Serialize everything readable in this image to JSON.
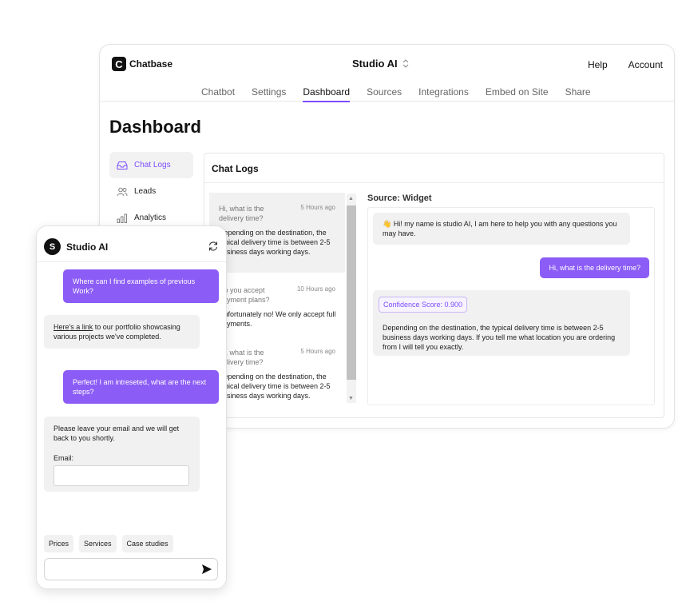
{
  "brand": {
    "name": "Chatbase",
    "logo_letter": "C"
  },
  "header": {
    "project": "Studio AI",
    "project_chevron": "⌃⌄",
    "links": {
      "help": "Help",
      "account": "Account"
    }
  },
  "tabs": [
    {
      "label": "Chatbot"
    },
    {
      "label": "Settings"
    },
    {
      "label": "Dashboard",
      "active": true
    },
    {
      "label": "Sources"
    },
    {
      "label": "Integrations"
    },
    {
      "label": "Embed on Site"
    },
    {
      "label": "Share"
    }
  ],
  "page_title": "Dashboard",
  "sidebar": {
    "items": [
      {
        "label": "Chat Logs",
        "icon": "inbox-icon",
        "active": true
      },
      {
        "label": "Leads",
        "icon": "users-icon"
      },
      {
        "label": "Analytics",
        "icon": "bar-chart-icon"
      }
    ]
  },
  "chat_logs": {
    "title": "Chat Logs",
    "items": [
      {
        "question": "Hi, what is the delivery time?",
        "time": "5 Hours ago",
        "answer": "Depending on the destination, the typical delivery time is between 2-5 business days working days."
      },
      {
        "question": "Do you accept payment plans?",
        "time": "10 Hours ago",
        "answer": "Unfortunately no! We only accept full payments."
      },
      {
        "question": "Hi, what is the delivery time?",
        "time": "5 Hours ago",
        "answer": "Depending on the destination, the typical delivery time is between 2-5 business days working days."
      }
    ]
  },
  "conversation": {
    "source": "Source: Widget",
    "bot_greeting": "👋 Hi! my name is studio AI, I am here to help you with any questions you may have.",
    "user_message": "Hi, what is the delivery time?",
    "confidence": "Confidence Score: 0.900",
    "bot_answer": "Depending on the destination, the typical delivery time is between 2-5 business days working days. If you tell me what location you are ordering from I will tell you exactly."
  },
  "widget": {
    "avatar_letter": "S",
    "title": "Studio AI",
    "messages": {
      "user1": "Where can I find examples of previous Work?",
      "bot1_link": "Here's a link",
      "bot1_rest": " to our portfolio showcasing various projects we've completed.",
      "user2": "Perfect! I am intreseted, what are the next steps?",
      "bot2": "Please leave your email and we will get back to you shortly.",
      "email_label": "Email:"
    },
    "email_value": "",
    "chips": [
      "Prices",
      "Services",
      "Case studies"
    ],
    "input_placeholder": ""
  },
  "colors": {
    "accent": "#8b5cf6",
    "accent_text": "#7c4dff"
  }
}
